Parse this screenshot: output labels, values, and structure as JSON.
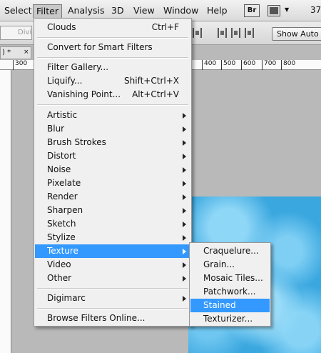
{
  "menubar": {
    "items": [
      "Select",
      "Filter",
      "Analysis",
      "3D",
      "View",
      "Window",
      "Help"
    ],
    "br_label": "Br",
    "zoom": "37"
  },
  "options": {
    "input_placeholder": "Divid",
    "show_auto": "Show Auto Sl"
  },
  "document": {
    "tab": ") * ",
    "close": "×"
  },
  "ruler": {
    "ticks": [
      "300",
      "400",
      "500",
      "600",
      "700",
      "800"
    ]
  },
  "filter_menu": {
    "clouds": {
      "label": "Clouds",
      "shortcut": "Ctrl+F"
    },
    "convert": "Convert for Smart Filters",
    "filter_gallery": "Filter Gallery...",
    "liquify": {
      "label": "Liquify...",
      "shortcut": "Shift+Ctrl+X"
    },
    "vanishing_point": {
      "label": "Vanishing Point...",
      "shortcut": "Alt+Ctrl+V"
    },
    "submenus": [
      "Artistic",
      "Blur",
      "Brush Strokes",
      "Distort",
      "Noise",
      "Pixelate",
      "Render",
      "Sharpen",
      "Sketch",
      "Stylize",
      "Texture",
      "Video",
      "Other"
    ],
    "digimarc": "Digimarc",
    "browse_online": "Browse Filters Online..."
  },
  "texture_menu": {
    "items": [
      "Craquelure...",
      "Grain...",
      "Mosaic Tiles...",
      "Patchwork...",
      "Stained Glass...",
      "Texturizer..."
    ],
    "highlighted": "Stained Glass..."
  },
  "colors": {
    "highlight": "#3399ff",
    "canvas_blue": "#3aa7df",
    "workspace": "#b9b9b9"
  }
}
